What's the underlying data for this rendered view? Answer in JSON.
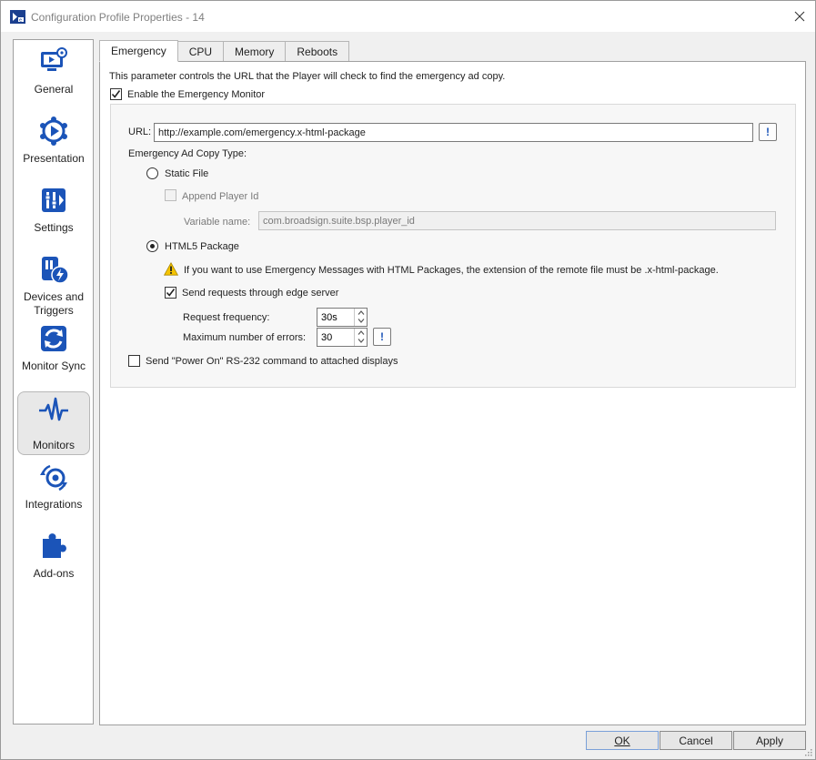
{
  "window": {
    "title": "Configuration Profile Properties - 14"
  },
  "sidebar": {
    "items": [
      {
        "label": "General",
        "icon": "monitor-gear-icon"
      },
      {
        "label": "Presentation",
        "icon": "play-network-icon"
      },
      {
        "label": "Settings",
        "icon": "sliders-icon"
      },
      {
        "label": "Devices and Triggers",
        "icon": "devices-lightning-icon"
      },
      {
        "label": "Monitor Sync",
        "icon": "sync-icon"
      },
      {
        "label": "Monitors",
        "icon": "pulse-icon"
      },
      {
        "label": "Integrations",
        "icon": "integrations-icon"
      },
      {
        "label": "Add-ons",
        "icon": "puzzle-icon"
      }
    ],
    "active": "Monitors"
  },
  "tabs": [
    "Emergency",
    "CPU",
    "Memory",
    "Reboots"
  ],
  "emergency": {
    "description": "This parameter controls the URL that the Player will check to find the emergency ad copy.",
    "enable_label": "Enable the Emergency Monitor",
    "enable_checked": true,
    "url_label": "URL:",
    "url_value": "http://example.com/emergency.x-html-package",
    "info_button": "!",
    "ad_copy_type_label": "Emergency Ad Copy Type:",
    "static_file_label": "Static File",
    "append_player_id_label": "Append Player Id",
    "variable_name_label": "Variable name:",
    "variable_name_value": "com.broadsign.suite.bsp.player_id",
    "html5_label": "HTML5 Package",
    "selected_type": "HTML5 Package",
    "warning_text": "If you want to use Emergency Messages with HTML Packages, the extension of the remote file must be .x-html-package.",
    "edge_server_label": "Send requests through edge server",
    "edge_server_checked": true,
    "request_frequency_label": "Request frequency:",
    "request_frequency_value": "30s",
    "max_errors_label": "Maximum number of errors:",
    "max_errors_value": "30",
    "power_on_label": "Send \"Power On\" RS-232 command to attached displays",
    "power_on_checked": false
  },
  "buttons": {
    "ok": "OK",
    "cancel": "Cancel",
    "apply": "Apply"
  },
  "colors": {
    "accent": "#1b54b8",
    "warning": "#f5c400"
  }
}
